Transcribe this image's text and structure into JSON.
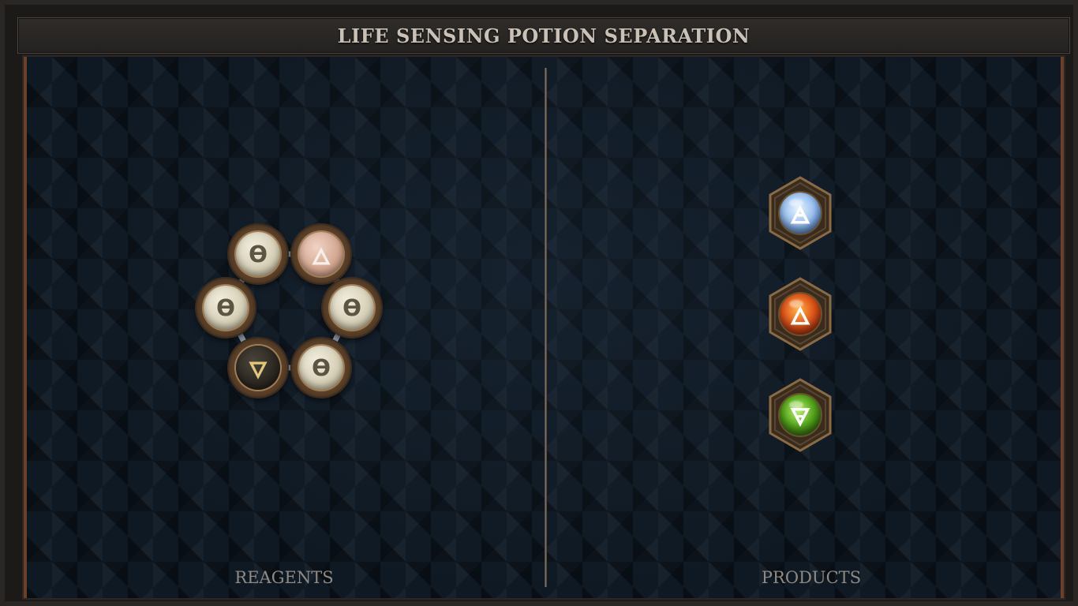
{
  "window": {
    "title": "LIFE SENSING POTION SEPARATION"
  },
  "reagents": {
    "label": "REAGENTS",
    "ring": [
      {
        "symbol": "ϴ",
        "color": "cream"
      },
      {
        "symbol": "🜂",
        "color": "pink"
      },
      {
        "symbol": "ϴ",
        "color": "cream"
      },
      {
        "symbol": "ϴ",
        "color": "cream"
      },
      {
        "symbol": "🜄",
        "color": "dark"
      },
      {
        "symbol": "ϴ",
        "color": "cream"
      }
    ]
  },
  "products": {
    "label": "PRODUCTS",
    "items": [
      {
        "element": "air",
        "symbol": "🜁",
        "color": "#9cc3ef"
      },
      {
        "element": "fire",
        "symbol": "🜂",
        "color": "#e0581a"
      },
      {
        "element": "earth",
        "symbol": "🜃",
        "color": "#56a81c"
      }
    ]
  },
  "colors": {
    "accent_border": "#6b4026",
    "background": "#0f1923",
    "title_text": "#c9c1b5"
  }
}
